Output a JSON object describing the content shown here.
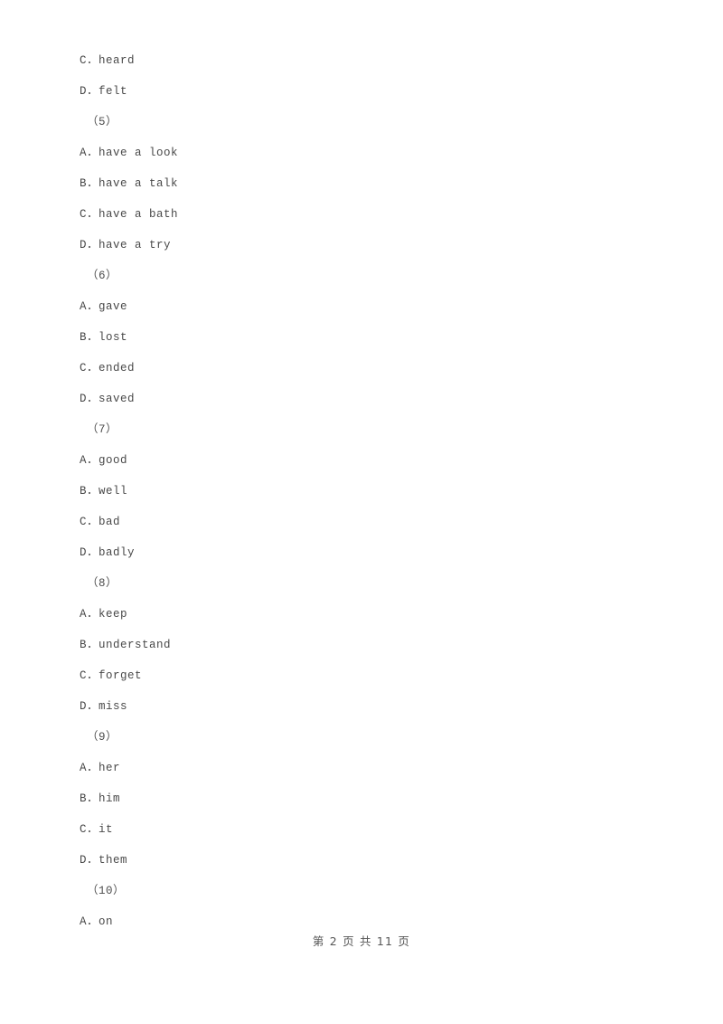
{
  "document": {
    "page_background": "#ffffff",
    "text_color": "#494949",
    "lines": [
      {
        "kind": "option",
        "text": "C．heard"
      },
      {
        "kind": "option",
        "text": "D．felt"
      },
      {
        "kind": "question",
        "text": "（5）"
      },
      {
        "kind": "option",
        "text": "A．have a look"
      },
      {
        "kind": "option",
        "text": "B．have a talk"
      },
      {
        "kind": "option",
        "text": "C．have a bath"
      },
      {
        "kind": "option",
        "text": "D．have a try"
      },
      {
        "kind": "question",
        "text": "（6）"
      },
      {
        "kind": "option",
        "text": "A．gave"
      },
      {
        "kind": "option",
        "text": "B．lost"
      },
      {
        "kind": "option",
        "text": "C．ended"
      },
      {
        "kind": "option",
        "text": "D．saved"
      },
      {
        "kind": "question",
        "text": "（7）"
      },
      {
        "kind": "option",
        "text": "A．good"
      },
      {
        "kind": "option",
        "text": "B．well"
      },
      {
        "kind": "option",
        "text": "C．bad"
      },
      {
        "kind": "option",
        "text": "D．badly"
      },
      {
        "kind": "question",
        "text": "（8）"
      },
      {
        "kind": "option",
        "text": "A．keep"
      },
      {
        "kind": "option",
        "text": "B．understand"
      },
      {
        "kind": "option",
        "text": "C．forget"
      },
      {
        "kind": "option",
        "text": "D．miss"
      },
      {
        "kind": "question",
        "text": "（9）"
      },
      {
        "kind": "option",
        "text": "A．her"
      },
      {
        "kind": "option",
        "text": "B．him"
      },
      {
        "kind": "option",
        "text": "C．it"
      },
      {
        "kind": "option",
        "text": "D．them"
      },
      {
        "kind": "question",
        "text": "（10）"
      },
      {
        "kind": "option",
        "text": "A．on"
      }
    ]
  },
  "footer": {
    "page_label": "第 2 页 共 11 页",
    "current_page": 2,
    "total_pages": 11
  }
}
